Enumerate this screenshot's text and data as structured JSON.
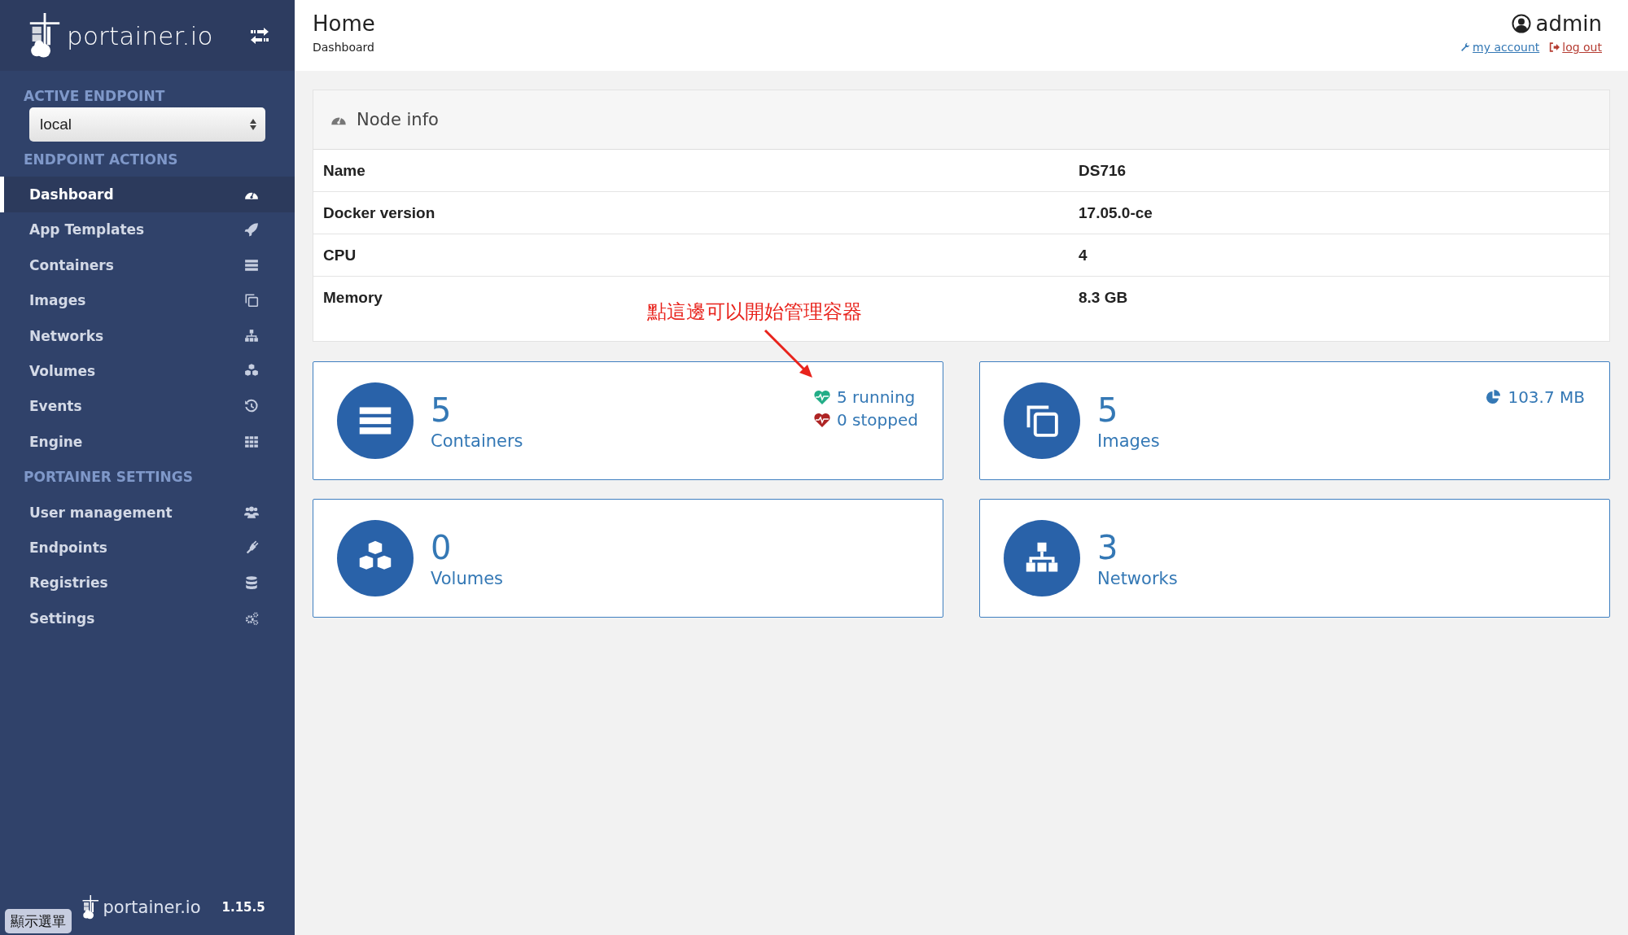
{
  "sidebar": {
    "logo": "portainer.io",
    "active_endpoint_label": "ACTIVE ENDPOINT",
    "endpoint_select": {
      "value": "local"
    },
    "sections": [
      {
        "title": "ENDPOINT ACTIONS",
        "items": [
          {
            "label": "Dashboard",
            "kind": "dashboard",
            "selected": true
          },
          {
            "label": "App Templates",
            "kind": "rocket",
            "selected": false
          },
          {
            "label": "Containers",
            "kind": "server",
            "selected": false
          },
          {
            "label": "Images",
            "kind": "copy",
            "selected": false
          },
          {
            "label": "Networks",
            "kind": "sitemap",
            "selected": false
          },
          {
            "label": "Volumes",
            "kind": "cubes",
            "selected": false
          },
          {
            "label": "Events",
            "kind": "history",
            "selected": false
          },
          {
            "label": "Engine",
            "kind": "grid",
            "selected": false
          }
        ]
      },
      {
        "title": "PORTAINER SETTINGS",
        "items": [
          {
            "label": "User management",
            "kind": "users",
            "selected": false
          },
          {
            "label": "Endpoints",
            "kind": "plug",
            "selected": false
          },
          {
            "label": "Registries",
            "kind": "database",
            "selected": false
          },
          {
            "label": "Settings",
            "kind": "gears",
            "selected": false
          }
        ]
      }
    ],
    "footer": {
      "logo": "portainer.io",
      "version": "1.15.5"
    }
  },
  "overlay_button": "顯示選單",
  "header": {
    "title": "Home",
    "breadcrumb": "Dashboard",
    "user": "admin",
    "links": [
      {
        "label": "my account",
        "kind": "account"
      },
      {
        "label": "log out",
        "kind": "logout"
      }
    ]
  },
  "node_info": {
    "title": "Node info",
    "rows": [
      {
        "label": "Name",
        "value": "DS716"
      },
      {
        "label": "Docker version",
        "value": "17.05.0-ce"
      },
      {
        "label": "CPU",
        "value": "4"
      },
      {
        "label": "Memory",
        "value": "8.3 GB"
      }
    ]
  },
  "annotation": {
    "text": "點這邊可以開始管理容器"
  },
  "tiles": [
    {
      "kind": "server",
      "count": "5",
      "label": "Containers",
      "stats": [
        {
          "kind": "running",
          "text": "5 running"
        },
        {
          "kind": "stopped",
          "text": "0 stopped"
        }
      ]
    },
    {
      "kind": "copy",
      "count": "5",
      "label": "Images",
      "stats": [
        {
          "kind": "size",
          "text": "103.7 MB"
        }
      ]
    },
    {
      "kind": "cubes",
      "count": "0",
      "label": "Volumes"
    },
    {
      "kind": "sitemap",
      "count": "3",
      "label": "Networks"
    }
  ]
}
